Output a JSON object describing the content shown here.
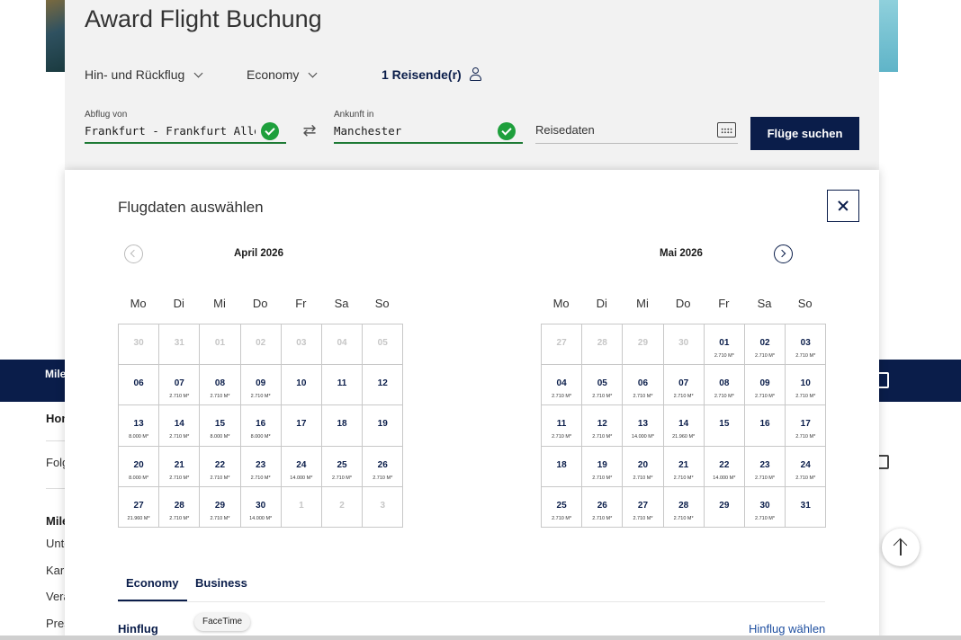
{
  "background": {
    "nav_brand": "Miles & More",
    "side_texts": [
      "Home",
      "Folgen Sie uns",
      "Miles & More",
      "Unternehmen",
      "Karriere",
      "Verantwortung",
      "Presse"
    ]
  },
  "search": {
    "title": "Award Flight Buchung",
    "trip_type": "Hin- und Rückflug",
    "cabin": "Economy",
    "travellers": "1 Reisende(r)",
    "departure_label": "Abflug von",
    "departure_value": "Frankfurt - Frankfurt Alle Flughäfen",
    "arrival_label": "Ankunft in",
    "arrival_value": "Manchester",
    "dates_placeholder": "Reisedaten",
    "search_button": "Flüge suchen"
  },
  "modal": {
    "title": "Flugdaten auswählen",
    "weekdays": [
      "Mo",
      "Di",
      "Mi",
      "Do",
      "Fr",
      "Sa",
      "So"
    ],
    "months": [
      {
        "title": "April 2026",
        "days": [
          {
            "d": "30",
            "off": true
          },
          {
            "d": "31",
            "off": true
          },
          {
            "d": "01",
            "off": true
          },
          {
            "d": "02",
            "off": true
          },
          {
            "d": "03",
            "off": true
          },
          {
            "d": "04",
            "off": true
          },
          {
            "d": "05",
            "off": true
          },
          {
            "d": "06"
          },
          {
            "d": "07",
            "m": "2.710 M*"
          },
          {
            "d": "08",
            "m": "2.710 M*"
          },
          {
            "d": "09",
            "m": "2.710 M*"
          },
          {
            "d": "10"
          },
          {
            "d": "11"
          },
          {
            "d": "12"
          },
          {
            "d": "13",
            "m": "8.000 M*"
          },
          {
            "d": "14",
            "m": "2.710 M*"
          },
          {
            "d": "15",
            "m": "8.000 M*"
          },
          {
            "d": "16",
            "m": "8.000 M*"
          },
          {
            "d": "17"
          },
          {
            "d": "18"
          },
          {
            "d": "19"
          },
          {
            "d": "20",
            "m": "8.000 M*"
          },
          {
            "d": "21",
            "m": "2.710 M*"
          },
          {
            "d": "22",
            "m": "2.710 M*"
          },
          {
            "d": "23",
            "m": "2.710 M*"
          },
          {
            "d": "24",
            "m": "14.000 M*"
          },
          {
            "d": "25",
            "m": "2.710 M*"
          },
          {
            "d": "26",
            "m": "2.710 M*"
          },
          {
            "d": "27",
            "m": "21.960 M*"
          },
          {
            "d": "28",
            "m": "2.710 M*"
          },
          {
            "d": "29",
            "m": "2.710 M*"
          },
          {
            "d": "30",
            "m": "14.000 M*"
          },
          {
            "d": "1",
            "off": true
          },
          {
            "d": "2",
            "off": true
          },
          {
            "d": "3",
            "off": true
          }
        ]
      },
      {
        "title": "Mai 2026",
        "days": [
          {
            "d": "27",
            "off": true
          },
          {
            "d": "28",
            "off": true
          },
          {
            "d": "29",
            "off": true
          },
          {
            "d": "30",
            "off": true
          },
          {
            "d": "01",
            "m": "2.710 M*"
          },
          {
            "d": "02",
            "m": "2.710 M*"
          },
          {
            "d": "03",
            "m": "2.710 M*"
          },
          {
            "d": "04",
            "m": "2.710 M*"
          },
          {
            "d": "05",
            "m": "2.710 M*"
          },
          {
            "d": "06",
            "m": "2.710 M*"
          },
          {
            "d": "07",
            "m": "2.710 M*"
          },
          {
            "d": "08",
            "m": "2.710 M*"
          },
          {
            "d": "09",
            "m": "2.710 M*"
          },
          {
            "d": "10",
            "m": "2.710 M*"
          },
          {
            "d": "11",
            "m": "2.710 M*"
          },
          {
            "d": "12",
            "m": "2.710 M*"
          },
          {
            "d": "13",
            "m": "14.000 M*"
          },
          {
            "d": "14",
            "m": "21.960 M*"
          },
          {
            "d": "15"
          },
          {
            "d": "16"
          },
          {
            "d": "17",
            "m": "2.710 M*"
          },
          {
            "d": "18"
          },
          {
            "d": "19",
            "m": "2.710 M*"
          },
          {
            "d": "20",
            "m": "2.710 M*"
          },
          {
            "d": "21",
            "m": "2.710 M*"
          },
          {
            "d": "22",
            "m": "14.000 M*"
          },
          {
            "d": "23",
            "m": "2.710 M*"
          },
          {
            "d": "24",
            "m": "2.710 M*"
          },
          {
            "d": "25",
            "m": "2.710 M*"
          },
          {
            "d": "26",
            "m": "2.710 M*"
          },
          {
            "d": "27",
            "m": "2.710 M*"
          },
          {
            "d": "28",
            "m": "2.710 M*"
          },
          {
            "d": "29"
          },
          {
            "d": "30",
            "m": "2.710 M*"
          },
          {
            "d": "31"
          }
        ]
      }
    ],
    "tabs": [
      "Economy",
      "Business"
    ],
    "active_tab": "Economy",
    "outbound_label": "Hinflug",
    "outbound_link": "Hinflug wählen"
  },
  "tooltip": "FaceTime",
  "colors": {
    "brand_navy": "#0a1d4a",
    "valid_green": "#1e9f3c",
    "link_blue": "#1f4fa0"
  }
}
